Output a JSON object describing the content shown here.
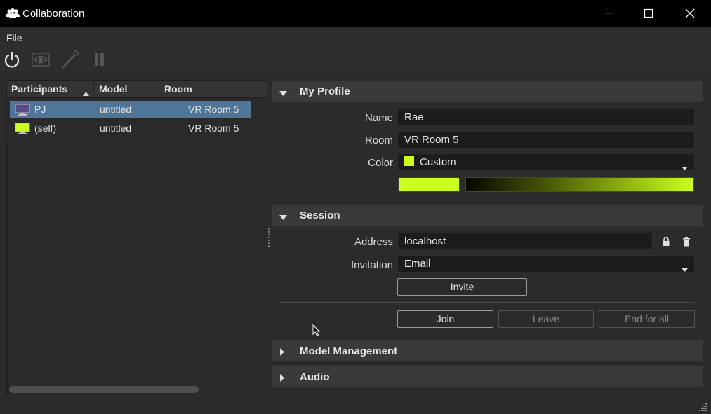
{
  "window": {
    "title": "Collaboration",
    "icon": "people-icon"
  },
  "menu": {
    "file_label": "File"
  },
  "toolbar": {
    "buttons": [
      {
        "icon": "power-icon",
        "enabled": true
      },
      {
        "icon": "eye-icon",
        "enabled": false
      },
      {
        "icon": "laser-pointer-icon",
        "enabled": false
      },
      {
        "icon": "pause-icon",
        "enabled": false
      }
    ]
  },
  "participants": {
    "columns": [
      "Participants",
      "Model",
      "Room"
    ],
    "sort_column": "Participants",
    "rows": [
      {
        "name": "PJ",
        "model": "untitled",
        "room": "VR Room 5",
        "selected": true,
        "icon_color": "#5a4a8a"
      },
      {
        "name": "(self)",
        "model": "untitled",
        "room": "VR Room 5",
        "selected": false,
        "icon_color": "#ccff1f"
      }
    ]
  },
  "profile": {
    "section_title": "My Profile",
    "expanded": true,
    "name_label": "Name",
    "name_value": "Rae",
    "room_label": "Room",
    "room_value": "VR Room 5",
    "color_label": "Color",
    "color_value": "Custom",
    "color_hex": "#ccff1f"
  },
  "session": {
    "section_title": "Session",
    "expanded": true,
    "address_label": "Address",
    "address_value": "localhost",
    "invitation_label": "Invitation",
    "invitation_value": "Email",
    "invite_button": "Invite",
    "join_button": "Join",
    "leave_button": "Leave",
    "end_button": "End for all"
  },
  "model_management": {
    "section_title": "Model Management",
    "expanded": false
  },
  "audio": {
    "section_title": "Audio",
    "expanded": false
  },
  "colors": {
    "selection": "#4f7699",
    "accent": "#ccff1f",
    "panel": "#2b2b2b"
  }
}
